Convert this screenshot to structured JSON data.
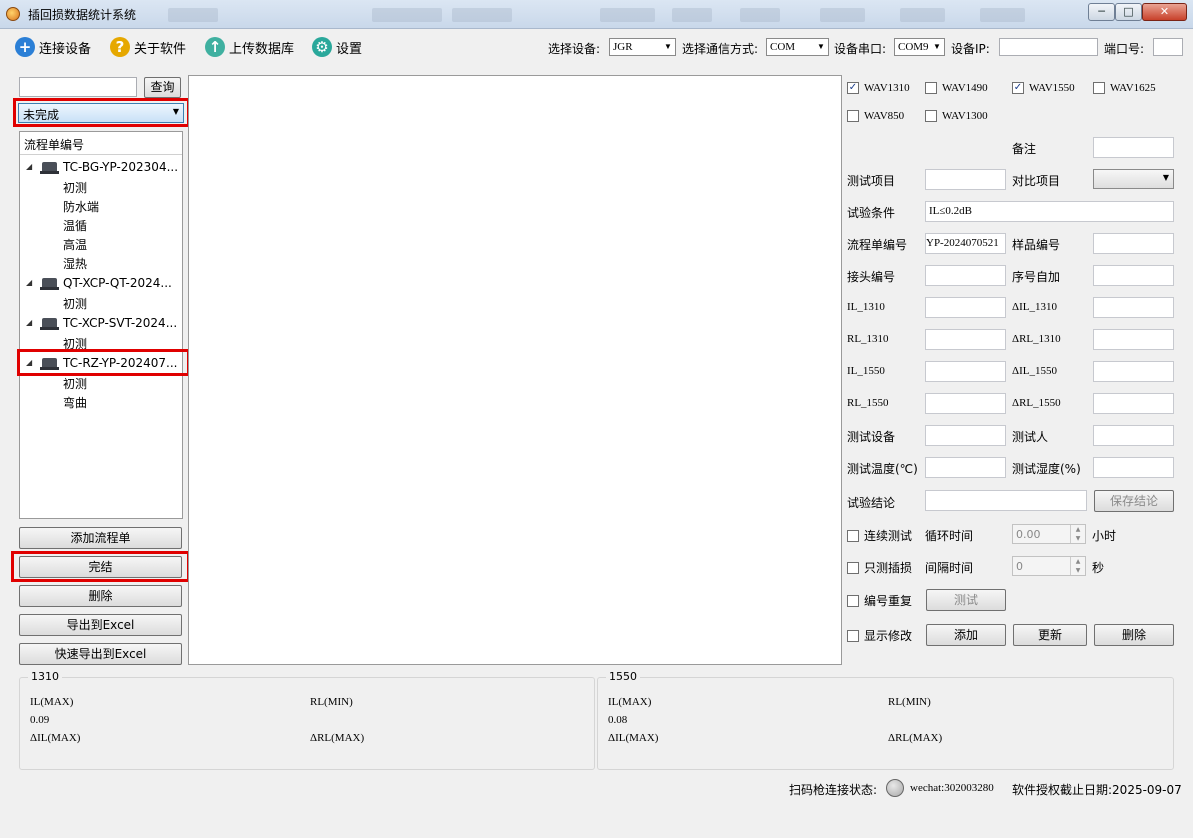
{
  "window": {
    "title": "插回损数据统计系统",
    "minimize": "─",
    "maximize": "□",
    "close": "✕"
  },
  "toolbar": {
    "connect": "连接设备",
    "about": "关于软件",
    "upload": "上传数据库",
    "settings": "设置",
    "select_device_label": "选择设备:",
    "select_device_value": "JGR",
    "comm_label": "选择通信方式:",
    "comm_value": "COM",
    "serial_label": "设备串口:",
    "serial_value": "COM9",
    "ip_label": "设备IP:",
    "ip_value": "",
    "port_label": "端口号:",
    "port_value": ""
  },
  "left": {
    "search_value": "",
    "search_button": "查询",
    "status_value": "未完成",
    "tree_header": "流程单编号",
    "tree": [
      {
        "label": "TC-BG-YP-202304...",
        "children": [
          "初测",
          "防水端",
          "温循",
          "高温",
          "湿热"
        ]
      },
      {
        "label": "QT-XCP-QT-2024...",
        "children": [
          "初测"
        ]
      },
      {
        "label": "TC-XCP-SVT-2024...",
        "children": [
          "初测"
        ]
      },
      {
        "label": "TC-RZ-YP-202407...",
        "children": [
          "初测",
          "弯曲"
        ]
      }
    ],
    "buttons": {
      "add": "添加流程单",
      "finish": "完结",
      "delete": "删除",
      "export": "导出到Excel",
      "quick_export": "快速导出到Excel"
    }
  },
  "form": {
    "wavelengths": [
      {
        "label": "WAV1310",
        "checked": true
      },
      {
        "label": "WAV1490",
        "checked": false
      },
      {
        "label": "WAV1550",
        "checked": true
      },
      {
        "label": "WAV1625",
        "checked": false
      },
      {
        "label": "WAV850",
        "checked": false
      },
      {
        "label": "WAV1300",
        "checked": false
      }
    ],
    "remark_label": "备注",
    "test_item_label": "测试项目",
    "compare_item_label": "对比项目",
    "condition_label": "试验条件",
    "condition_value": "IL≤0.2dB",
    "flow_no_label": "流程单编号",
    "flow_no_value": "YP-2024070521",
    "sample_no_label": "样品编号",
    "connector_no_label": "接头编号",
    "auto_inc_label": "序号自加",
    "il1310": "IL_1310",
    "dil1310": "ΔIL_1310",
    "rl1310": "RL_1310",
    "drl1310": "ΔRL_1310",
    "il1550": "IL_1550",
    "dil1550": "ΔIL_1550",
    "rl1550": "RL_1550",
    "drl1550": "ΔRL_1550",
    "test_device_label": "测试设备",
    "tester_label": "测试人",
    "temp_label": "测试温度(℃)",
    "humidity_label": "测试湿度(%)",
    "conclusion_label": "试验结论",
    "save_conclusion": "保存结论",
    "continuous_label": "连续测试",
    "cycle_label": "循环时间",
    "cycle_value": "0.00",
    "hour_unit": "小时",
    "il_only_label": "只测插损",
    "interval_label": "间隔时间",
    "interval_value": "0",
    "sec_unit": "秒",
    "repeat_label": "编号重复",
    "test_button": "测试",
    "show_modify_label": "显示修改",
    "add_button": "添加",
    "update_button": "更新",
    "delete_button": "删除"
  },
  "summary": {
    "g1310": {
      "title": "1310",
      "il_max": "IL(MAX)",
      "il_value": "0.09",
      "rl_min": "RL(MIN)",
      "dil_max": "ΔIL(MAX)",
      "drl_max": "ΔRL(MAX)"
    },
    "g1550": {
      "title": "1550",
      "il_max": "IL(MAX)",
      "il_value": "0.08",
      "rl_min": "RL(MIN)",
      "dil_max": "ΔIL(MAX)",
      "drl_max": "ΔRL(MAX)"
    }
  },
  "status": {
    "scanner_label": "扫码枪连接状态:",
    "wechat": "wechat:302003280",
    "license": "软件授权截止日期:2025-09-07"
  }
}
